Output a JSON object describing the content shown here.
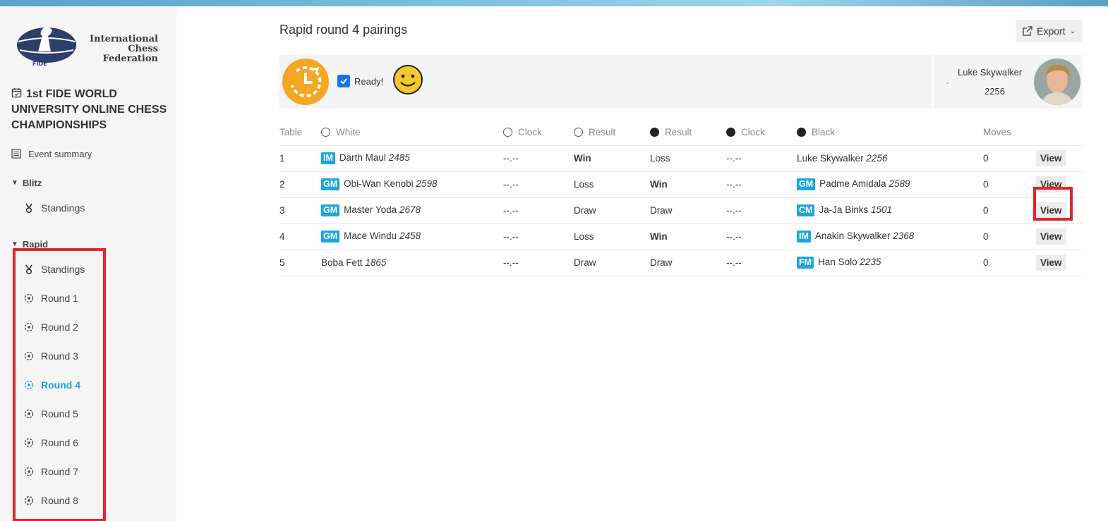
{
  "org": {
    "logo_text": "International Chess Federation",
    "logo_mark": "FIDE"
  },
  "event": {
    "title": "1st FIDE WORLD UNIVERSITY ONLINE CHESS CHAMPIONSHIPS"
  },
  "sidebar": {
    "event_summary": "Event summary",
    "blitz": {
      "label": "Blitz",
      "standings": "Standings"
    },
    "rapid": {
      "label": "Rapid",
      "standings": "Standings",
      "rounds": [
        "Round 1",
        "Round 2",
        "Round 3",
        "Round 4",
        "Round 5",
        "Round 6",
        "Round 7",
        "Round 8"
      ],
      "active_round": "Round 4"
    }
  },
  "page": {
    "title": "Rapid round 4 pairings",
    "export_label": "Export"
  },
  "status": {
    "ready_label": "Ready!",
    "ready_checked": true
  },
  "player": {
    "name": "Luke Skywalker",
    "rating": "2256"
  },
  "table": {
    "headers": {
      "table": "Table",
      "white": "White",
      "white_clock": "Clock",
      "white_result": "Result",
      "black_result": "Result",
      "black_clock": "Clock",
      "black": "Black",
      "moves": "Moves"
    },
    "rows": [
      {
        "table": "1",
        "white_title": "IM",
        "white_name": "Darth Maul",
        "white_rating": "2485",
        "white_clock": "--.--",
        "white_result": "Win",
        "white_bold": true,
        "black_result": "Loss",
        "black_bold": false,
        "black_clock": "--.--",
        "black_title": "",
        "black_name": "Luke Skywalker",
        "black_rating": "2256",
        "moves": "0",
        "view": "View"
      },
      {
        "table": "2",
        "white_title": "GM",
        "white_name": "Obi-Wan Kenobi",
        "white_rating": "2598",
        "white_clock": "--.--",
        "white_result": "Loss",
        "white_bold": false,
        "black_result": "Win",
        "black_bold": true,
        "black_clock": "--.--",
        "black_title": "GM",
        "black_name": "Padme Amidala",
        "black_rating": "2589",
        "moves": "0",
        "view": "View"
      },
      {
        "table": "3",
        "white_title": "GM",
        "white_name": "Master Yoda",
        "white_rating": "2678",
        "white_clock": "--.--",
        "white_result": "Draw",
        "white_bold": false,
        "black_result": "Draw",
        "black_bold": false,
        "black_clock": "--.--",
        "black_title": "CM",
        "black_name": "Ja-Ja Binks",
        "black_rating": "1501",
        "moves": "0",
        "view": "View"
      },
      {
        "table": "4",
        "white_title": "GM",
        "white_name": "Mace Windu",
        "white_rating": "2458",
        "white_clock": "--.--",
        "white_result": "Loss",
        "white_bold": false,
        "black_result": "Win",
        "black_bold": true,
        "black_clock": "--.--",
        "black_title": "IM",
        "black_name": "Anakin Skywalker",
        "black_rating": "2368",
        "moves": "0",
        "view": "View"
      },
      {
        "table": "5",
        "white_title": "",
        "white_name": "Boba Fett",
        "white_rating": "1865",
        "white_clock": "--.--",
        "white_result": "Draw",
        "white_bold": false,
        "black_result": "Draw",
        "black_bold": false,
        "black_clock": "--.--",
        "black_title": "FM",
        "black_name": "Han Solo",
        "black_rating": "2235",
        "moves": "0",
        "view": "View"
      }
    ]
  },
  "colors": {
    "accent": "#1fa0d8",
    "badge": "#1ba5dc",
    "highlight": "#e1252f",
    "clock_orange": "#f5a623"
  }
}
